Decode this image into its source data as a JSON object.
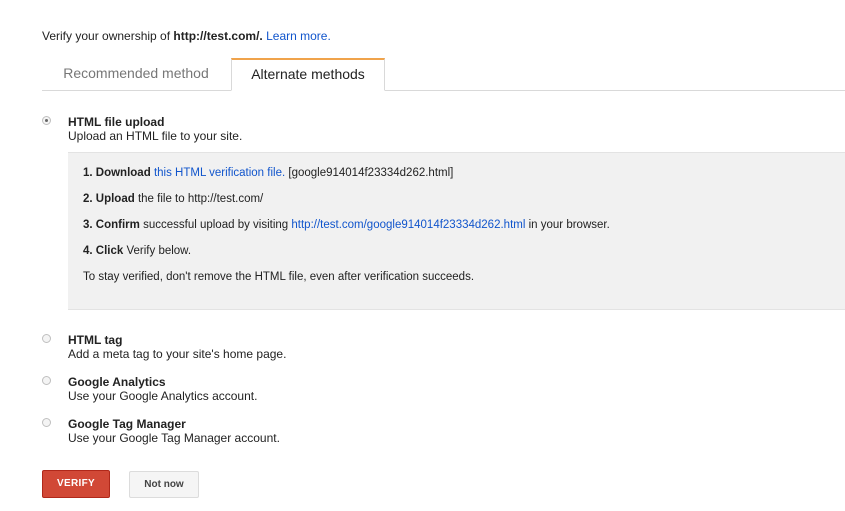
{
  "header": {
    "prefix": "Verify your ownership of ",
    "site": "http://test.com/.",
    "learn_more": "Learn more."
  },
  "tabs": [
    {
      "label": "Recommended method",
      "active": false
    },
    {
      "label": "Alternate methods",
      "active": true
    }
  ],
  "options": [
    {
      "title": "HTML file upload",
      "description": "Upload an HTML file to your site.",
      "selected": true
    },
    {
      "title": "HTML tag",
      "description": "Add a meta tag to your site's home page.",
      "selected": false
    },
    {
      "title": "Google Analytics",
      "description": "Use your Google Analytics account.",
      "selected": false
    },
    {
      "title": "Google Tag Manager",
      "description": "Use your Google Tag Manager account.",
      "selected": false
    }
  ],
  "instructions": {
    "step1": {
      "bold": "1. Download",
      "link": "this HTML verification file.",
      "rest": "[google914014f23334d262.html]"
    },
    "step2": {
      "bold": "2. Upload",
      "rest": "the file to http://test.com/"
    },
    "step3": {
      "bold": "3. Confirm",
      "rest_before": "successful upload by visiting",
      "link": "http://test.com/google914014f23334d262.html",
      "rest_after": "in your browser."
    },
    "step4": {
      "bold": "4. Click",
      "rest": "Verify below."
    },
    "note": "To stay verified, don't remove the HTML file, even after verification succeeds."
  },
  "buttons": {
    "verify": "VERIFY",
    "not_now": "Not now"
  },
  "colors": {
    "link": "#1155cc",
    "verify_button": "#d14836",
    "active_tab_accent": "#f0a34b",
    "instructions_bg": "#f1f1f1"
  }
}
